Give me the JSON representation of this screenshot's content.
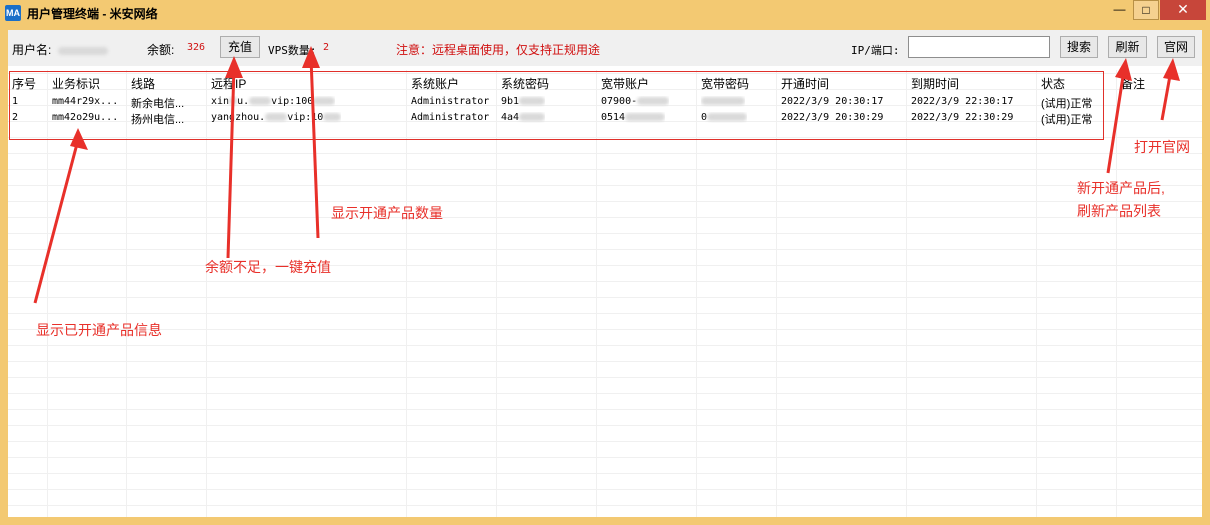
{
  "window": {
    "title": "用户管理终端 - 米安网络",
    "app_icon": "app-logo-icon",
    "controls": {
      "minimize": "—",
      "maximize": "□",
      "close": "✕"
    }
  },
  "toolbar": {
    "username_label": "用户名:",
    "balance_label": "余额:",
    "balance_value": "326",
    "recharge_button": "充值",
    "vps_count_label": "VPS数量:",
    "vps_count_value": "2",
    "notice": "注意：远程桌面使用，仅支持正规用途",
    "ip_port_label": "IP/端口:",
    "ip_port_value": "",
    "search_button": "搜索",
    "refresh_button": "刷新",
    "website_button": "官网"
  },
  "table": {
    "columns": [
      "序号",
      "业务标识",
      "线路",
      "远程IP",
      "系统账户",
      "系统密码",
      "宽带账户",
      "宽带密码",
      "开通时间",
      "到期时间",
      "状态",
      "备注"
    ],
    "rows": [
      {
        "index": "1",
        "business_id": "mm44r29x...",
        "line": "新余电信...",
        "remote_ip_a": "xin",
        "remote_ip_b": "u.",
        "remote_ip_c": "vip:100",
        "sys_account": "Administrator",
        "sys_password": "9b1",
        "broadband_account": "07900-",
        "broadband_password": "",
        "open_time": "2022/3/9 20:30:17",
        "expire_time": "2022/3/9 22:30:17",
        "status": "(试用)正常",
        "remark": ""
      },
      {
        "index": "2",
        "business_id": "mm42o29u...",
        "line": "扬州电信...",
        "remote_ip_a": "yangzhou.",
        "remote_ip_b": "",
        "remote_ip_c": "vip:10",
        "sys_account": "Administrator",
        "sys_password": "4a4",
        "broadband_account": "0514",
        "broadband_password": "0",
        "open_time": "2022/3/9 20:30:29",
        "expire_time": "2022/3/9 22:30:29",
        "status": "(试用)正常",
        "remark": ""
      }
    ]
  },
  "annotations": {
    "table_info": "显示已开通产品信息",
    "recharge": "余额不足，一键充值",
    "vps_count": "显示开通产品数量",
    "refresh_line1": "新开通产品后,",
    "refresh_line2": "刷新产品列表",
    "website": "打开官网",
    "color": "#e8302a"
  }
}
